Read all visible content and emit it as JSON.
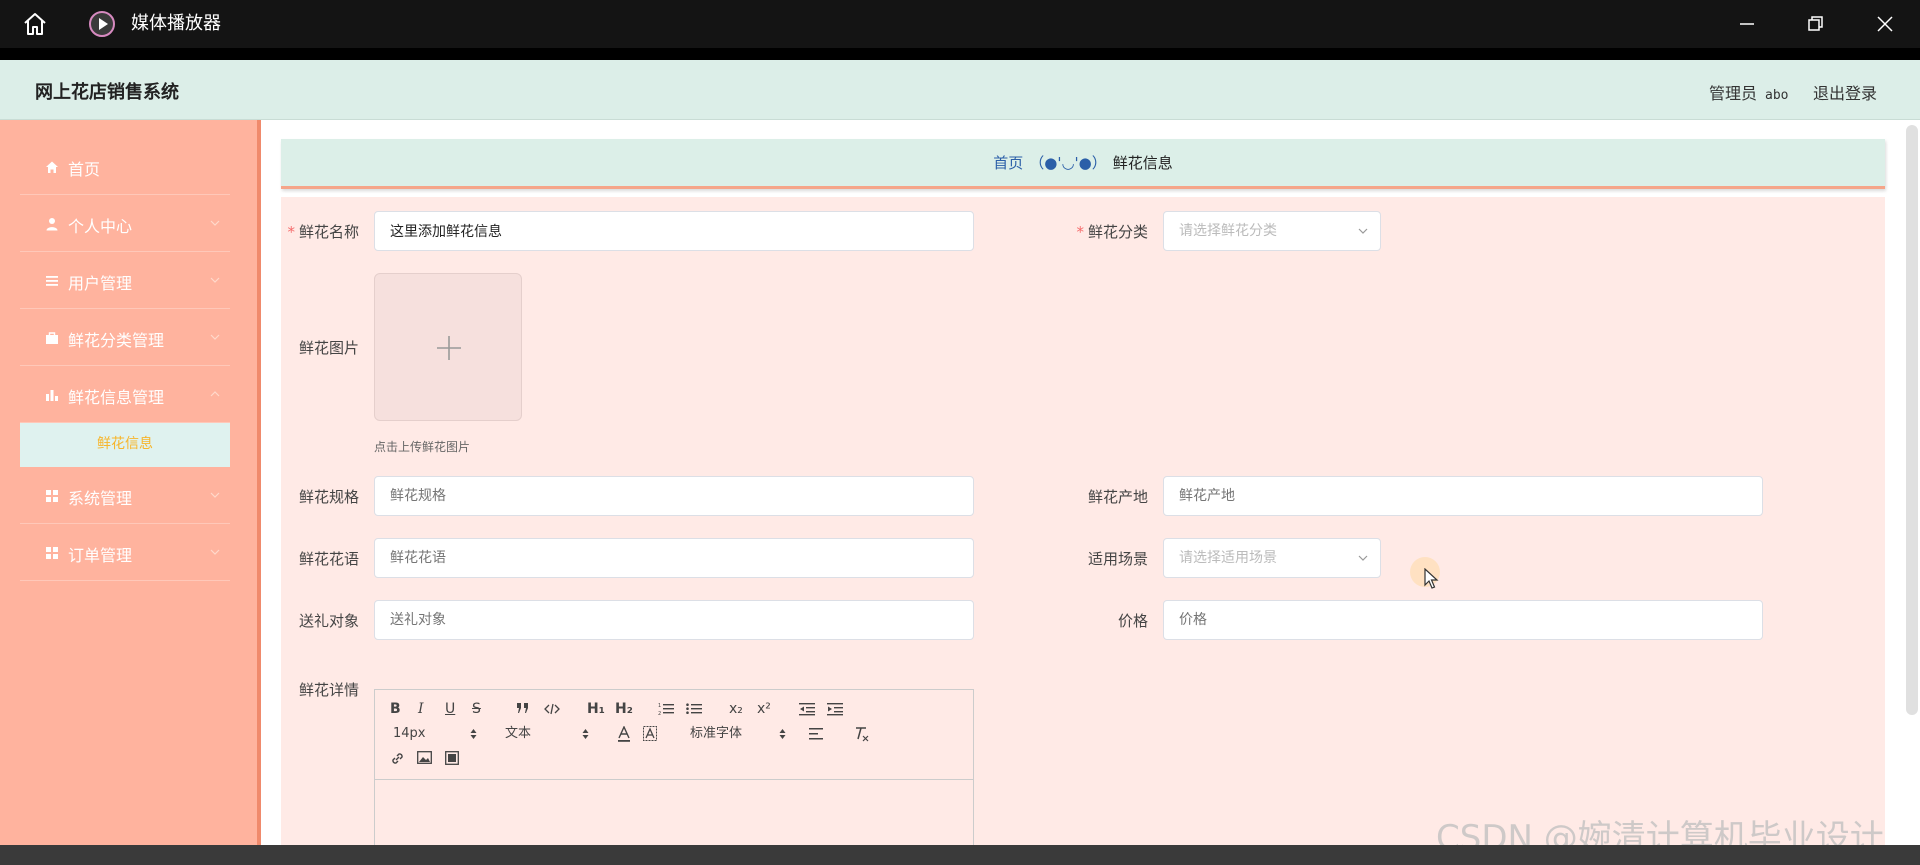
{
  "player": {
    "title": "媒体播放器",
    "icons": {
      "home": "home-icon",
      "logo": "play-circle-icon",
      "minimize": "minimize-icon",
      "restore": "restore-icon",
      "close": "close-icon"
    },
    "time_left": "",
    "time_right": ""
  },
  "header": {
    "app_title": "网上花店销售系统",
    "admin_role": "管理员",
    "admin_name": "abo",
    "logout": "退出登录"
  },
  "sidebar": {
    "items": [
      {
        "label": "首页",
        "icon": "home-icon",
        "expandable": false
      },
      {
        "label": "个人中心",
        "icon": "user-icon",
        "expandable": true
      },
      {
        "label": "用户管理",
        "icon": "list-icon",
        "expandable": true
      },
      {
        "label": "鲜花分类管理",
        "icon": "briefcase-icon",
        "expandable": true
      },
      {
        "label": "鲜花信息管理",
        "icon": "bar-chart-icon",
        "expandable": true
      },
      {
        "label": "系统管理",
        "icon": "grid-icon",
        "expandable": true
      },
      {
        "label": "订单管理",
        "icon": "grid-icon",
        "expandable": true
      }
    ],
    "active_submenu": "鲜花信息"
  },
  "breadcrumb": {
    "home": "首页",
    "face": "（●'◡'●）",
    "current": "鲜花信息"
  },
  "form": {
    "name": {
      "label": "鲜花名称",
      "value": "这里添加鲜花信息",
      "required": true
    },
    "category": {
      "label": "鲜花分类",
      "placeholder": "请选择鲜花分类",
      "required": true
    },
    "image": {
      "label": "鲜花图片",
      "hint": "点击上传鲜花图片"
    },
    "spec": {
      "label": "鲜花规格",
      "placeholder": "鲜花规格"
    },
    "origin": {
      "label": "鲜花产地",
      "placeholder": "鲜花产地"
    },
    "language": {
      "label": "鲜花花语",
      "placeholder": "鲜花花语"
    },
    "scene": {
      "label": "适用场景",
      "placeholder": "请选择适用场景"
    },
    "recipient": {
      "label": "送礼对象",
      "placeholder": "送礼对象"
    },
    "price": {
      "label": "价格",
      "placeholder": "价格"
    },
    "detail": {
      "label": "鲜花详情"
    }
  },
  "editor": {
    "font_size": "14px",
    "block_format": "文本",
    "font_family": "标准字体",
    "buttons": {
      "bold": "B",
      "italic": "I",
      "underline": "U",
      "strike": "S",
      "h1": "H₁",
      "h2": "H₂",
      "sub": "x₂",
      "sup": "x²"
    }
  },
  "watermark": "CSDN @婉清计算机毕业设计",
  "colors": {
    "sidebar_bg": "#ffb39e",
    "header_bg": "#dceee8",
    "form_bg": "#ffeae6",
    "submenu_text": "#f7b52a",
    "link_blue": "#2b5fa8",
    "required": "#f56c6c"
  }
}
